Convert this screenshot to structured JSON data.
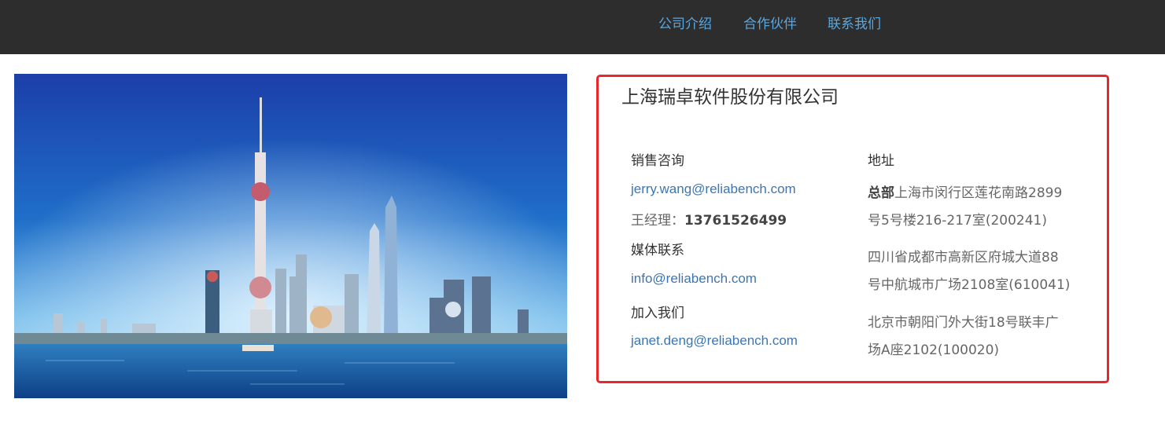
{
  "nav": {
    "items": [
      "公司介绍",
      "合作伙伴",
      "联系我们"
    ]
  },
  "company": {
    "name": "上海瑞卓软件股份有限公司"
  },
  "contacts": {
    "sales_label": "销售咨询",
    "sales_email": "jerry.wang@reliabench.com",
    "manager_prefix": "王经理：",
    "manager_phone": "13761526499",
    "media_label": "媒体联系",
    "media_email": "info@reliabench.com",
    "join_label": "加入我们",
    "join_email": "janet.deng@reliabench.com"
  },
  "address": {
    "label": "地址",
    "hq_tag": "总部",
    "hq_line1": "上海市闵行区莲花南路2899",
    "hq_line2": "号5号楼216-217室(200241)",
    "chengdu_line1": "四川省成都市高新区府城大道88",
    "chengdu_line2": "号中航城市广场2108室(610041)",
    "beijing_line1": "北京市朝阳门外大街18号联丰广",
    "beijing_line2": "场A座2102(100020)"
  },
  "colors": {
    "navbar_bg": "#2d2d2d",
    "nav_link": "#5aa7e0",
    "card_border": "#e8262b",
    "email_link": "#3b76b3"
  }
}
